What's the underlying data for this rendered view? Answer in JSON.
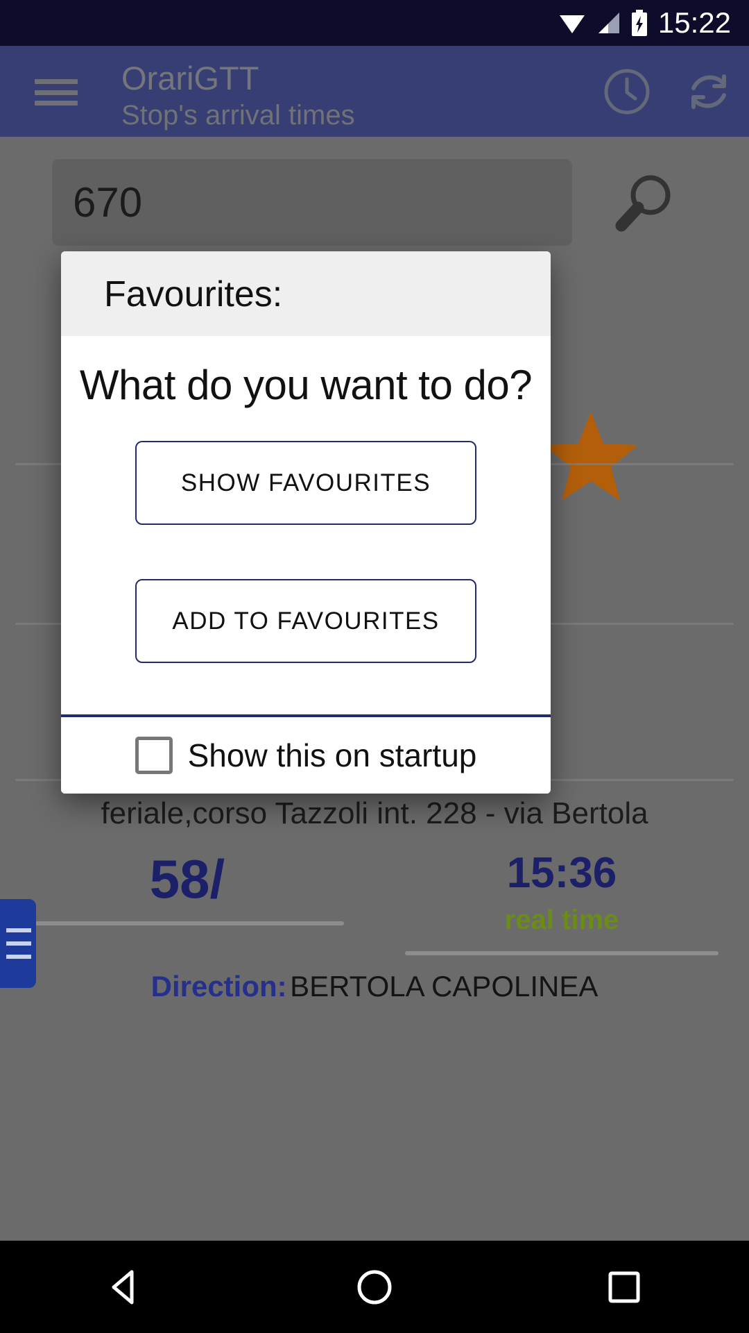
{
  "statusbar": {
    "time": "15:22",
    "icons": [
      "wifi-icon",
      "cell-signal-icon",
      "battery-charging-icon"
    ]
  },
  "appbar": {
    "menu_icon": "hamburger-menu-icon",
    "title": "OrariGTT",
    "subtitle": "Stop's arrival times",
    "actions": [
      {
        "icon": "clock-icon",
        "name": "clock-button"
      },
      {
        "icon": "refresh-icon",
        "name": "refresh-button"
      }
    ],
    "background_color": "#1e2a86"
  },
  "search": {
    "value": "670",
    "placeholder": "",
    "search_icon": "magnifier-icon",
    "favourite_icon": "star-icon",
    "favourite_color": "#b35f0a"
  },
  "stop": {
    "description": "feriale,corso Tazzoli int. 228 - via Bertola"
  },
  "arrival": {
    "line": "58/",
    "time": "15:36",
    "realtime_label": "real time",
    "realtime_color": "#6b8c15",
    "direction_label": "Direction:",
    "direction_value": "BERTOLA CAPOLINEA",
    "accent_color": "#1b2069"
  },
  "side_tab": {
    "icon": "drawer-handle-icon"
  },
  "dialog": {
    "header_title": "Favourites:",
    "question": "What do you want to do?",
    "buttons": [
      {
        "label": "SHOW FAVOURITES",
        "name": "show-favourites-button"
      },
      {
        "label": "ADD TO FAVOURITES",
        "name": "add-to-favourites-button"
      }
    ],
    "checkbox": {
      "label": "Show this on startup",
      "checked": false
    },
    "accent_color": "#242a6e",
    "header_bg": "#efefef"
  },
  "navbar": {
    "back": "back-triangle-icon",
    "home": "home-circle-icon",
    "recents": "recents-square-icon"
  }
}
